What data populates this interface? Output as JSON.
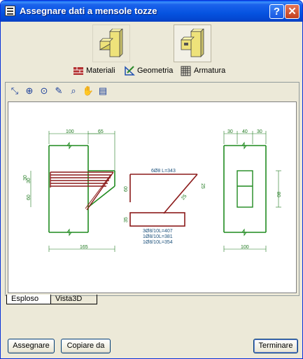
{
  "window": {
    "title": "Assegnare dati a mensole tozze"
  },
  "links": {
    "materials": "Materiali",
    "geometry": "Geometria",
    "reinforcement": "Armatura"
  },
  "drawing": {
    "dims_left_top": [
      "100",
      "65"
    ],
    "dims_left_side": [
      "30",
      "30",
      "60"
    ],
    "dim_left_bottom": "165",
    "bar_top_label": "6Ø8 L=343",
    "dim_bar_a": "60",
    "dim_bar_b": "25",
    "dim_bar_c": "35",
    "dim_bar_d": "25",
    "stirrup_labels": [
      "3Ø8/10L=407",
      "1Ø8/10L=381",
      "1Ø8/10L=354"
    ],
    "dims_right_top": [
      "30",
      "40",
      "30"
    ],
    "dim_right_side": "80",
    "dim_right_bottom": "100"
  },
  "tabs": {
    "exploded": "Esploso",
    "view3d": "Vista3D"
  },
  "buttons": {
    "assign": "Assegnare",
    "copy_from": "Copiare da",
    "finish": "Terminare"
  },
  "colors": {
    "titlebar": "#0553e0",
    "concrete": "#1f8a1f",
    "rebar": "#8b1a1a",
    "dims": "#217a21"
  }
}
